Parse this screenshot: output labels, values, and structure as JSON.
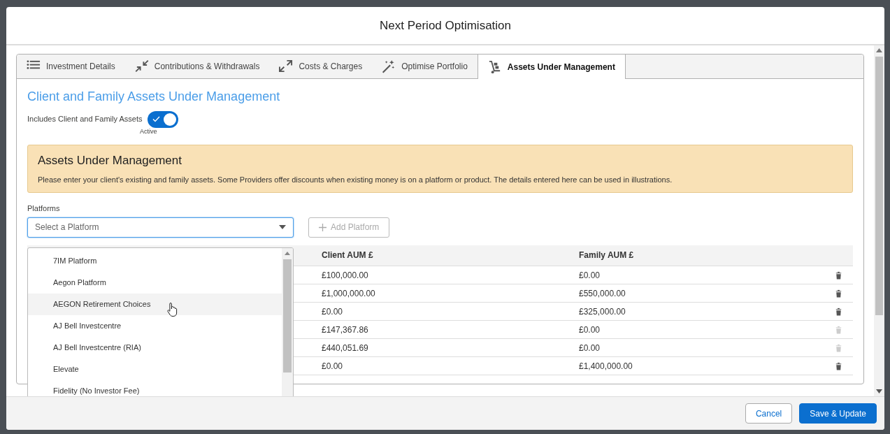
{
  "modal": {
    "title": "Next Period Optimisation"
  },
  "tabs": [
    {
      "label": "Investment Details",
      "selected": false
    },
    {
      "label": "Contributions & Withdrawals",
      "selected": false
    },
    {
      "label": "Costs & Charges",
      "selected": false
    },
    {
      "label": "Optimise Portfolio",
      "selected": false
    },
    {
      "label": "Assets Under Management",
      "selected": true
    }
  ],
  "section_title": "Client and Family Assets Under Management",
  "toggle": {
    "label": "Includes Client and Family Assets",
    "on": true,
    "status": "Active"
  },
  "notice": {
    "title": "Assets Under Management",
    "text": "Please enter your client's existing and family assets. Some Providers offer discounts when existing money is on a platform or product. The details entered here can be used in illustrations."
  },
  "platforms": {
    "label": "Platforms",
    "placeholder": "Select a Platform",
    "expanded": true,
    "options": [
      {
        "label": "7IM Platform",
        "highlighted": false
      },
      {
        "label": "Aegon Platform",
        "highlighted": false
      },
      {
        "label": "AEGON Retirement Choices",
        "highlighted": true
      },
      {
        "label": "AJ Bell Investcentre",
        "highlighted": false
      },
      {
        "label": "AJ Bell Investcentre (RIA)",
        "highlighted": false
      },
      {
        "label": "Elevate",
        "highlighted": false
      },
      {
        "label": "Fidelity (No Investor Fee)",
        "highlighted": false
      }
    ]
  },
  "add_button": {
    "label": "Add Platform",
    "disabled": true
  },
  "table": {
    "columns": [
      "Client AUM £",
      "Family AUM £"
    ],
    "rows": [
      {
        "client_aum": "£100,000.00",
        "family_aum": "£0.00",
        "delete_disabled": false
      },
      {
        "client_aum": "£1,000,000.00",
        "family_aum": "£550,000.00",
        "delete_disabled": false
      },
      {
        "client_aum": "£0.00",
        "family_aum": "£325,000.00",
        "delete_disabled": false
      },
      {
        "client_aum": "£147,367.86",
        "family_aum": "£0.00",
        "delete_disabled": true
      },
      {
        "client_aum": "£440,051.69",
        "family_aum": "£0.00",
        "delete_disabled": true
      },
      {
        "client_aum": "£0.00",
        "family_aum": "£1,400,000.00",
        "delete_disabled": false
      }
    ]
  },
  "footer": {
    "buttons": [
      {
        "label": "Cancel",
        "kind": "outline"
      },
      {
        "label": "Save & Update",
        "kind": "primary"
      }
    ]
  }
}
